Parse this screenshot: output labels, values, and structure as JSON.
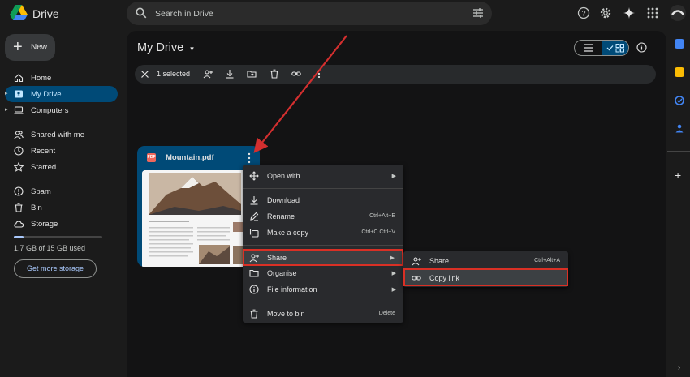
{
  "app": {
    "title": "Drive"
  },
  "search": {
    "placeholder": "Search in Drive"
  },
  "new_button": {
    "label": "New"
  },
  "sidebar": {
    "items": [
      {
        "label": "Home",
        "icon": "home-icon"
      },
      {
        "label": "My Drive",
        "icon": "my-drive-icon",
        "active": true
      },
      {
        "label": "Computers",
        "icon": "computer-icon"
      },
      {
        "label": "Shared with me",
        "icon": "people-icon"
      },
      {
        "label": "Recent",
        "icon": "clock-icon"
      },
      {
        "label": "Starred",
        "icon": "star-icon"
      },
      {
        "label": "Spam",
        "icon": "spam-icon"
      },
      {
        "label": "Bin",
        "icon": "bin-icon"
      },
      {
        "label": "Storage",
        "icon": "cloud-icon"
      }
    ],
    "storage_text": "1.7 GB of 15 GB used",
    "storage_used_fraction": 0.113,
    "get_storage_label": "Get more storage"
  },
  "main": {
    "title": "My Drive",
    "selection": {
      "count_label": "1 selected"
    }
  },
  "file": {
    "name": "Mountain.pdf",
    "badge": "PDF"
  },
  "context_menu": {
    "items": [
      {
        "label": "Open with",
        "icon": "open-with-icon",
        "submenu": true
      },
      {
        "label": "Download",
        "icon": "download-icon"
      },
      {
        "label": "Rename",
        "icon": "rename-icon",
        "shortcut": "Ctrl+Alt+E"
      },
      {
        "label": "Make a copy",
        "icon": "copy-icon",
        "shortcut": "Ctrl+C Ctrl+V"
      },
      {
        "label": "Share",
        "icon": "share-icon",
        "submenu": true,
        "highlighted": true
      },
      {
        "label": "Organise",
        "icon": "folder-icon",
        "submenu": true
      },
      {
        "label": "File information",
        "icon": "info-icon",
        "submenu": true
      },
      {
        "label": "Move to bin",
        "icon": "bin-icon",
        "shortcut": "Delete"
      }
    ]
  },
  "share_submenu": {
    "items": [
      {
        "label": "Share",
        "icon": "share-icon",
        "shortcut": "Ctrl+Alt+A"
      },
      {
        "label": "Copy link",
        "icon": "link-icon",
        "highlighted": true
      }
    ]
  },
  "colors": {
    "accent": "#004a77",
    "highlight_border": "#d93025",
    "arrow": "#d32f2f"
  }
}
